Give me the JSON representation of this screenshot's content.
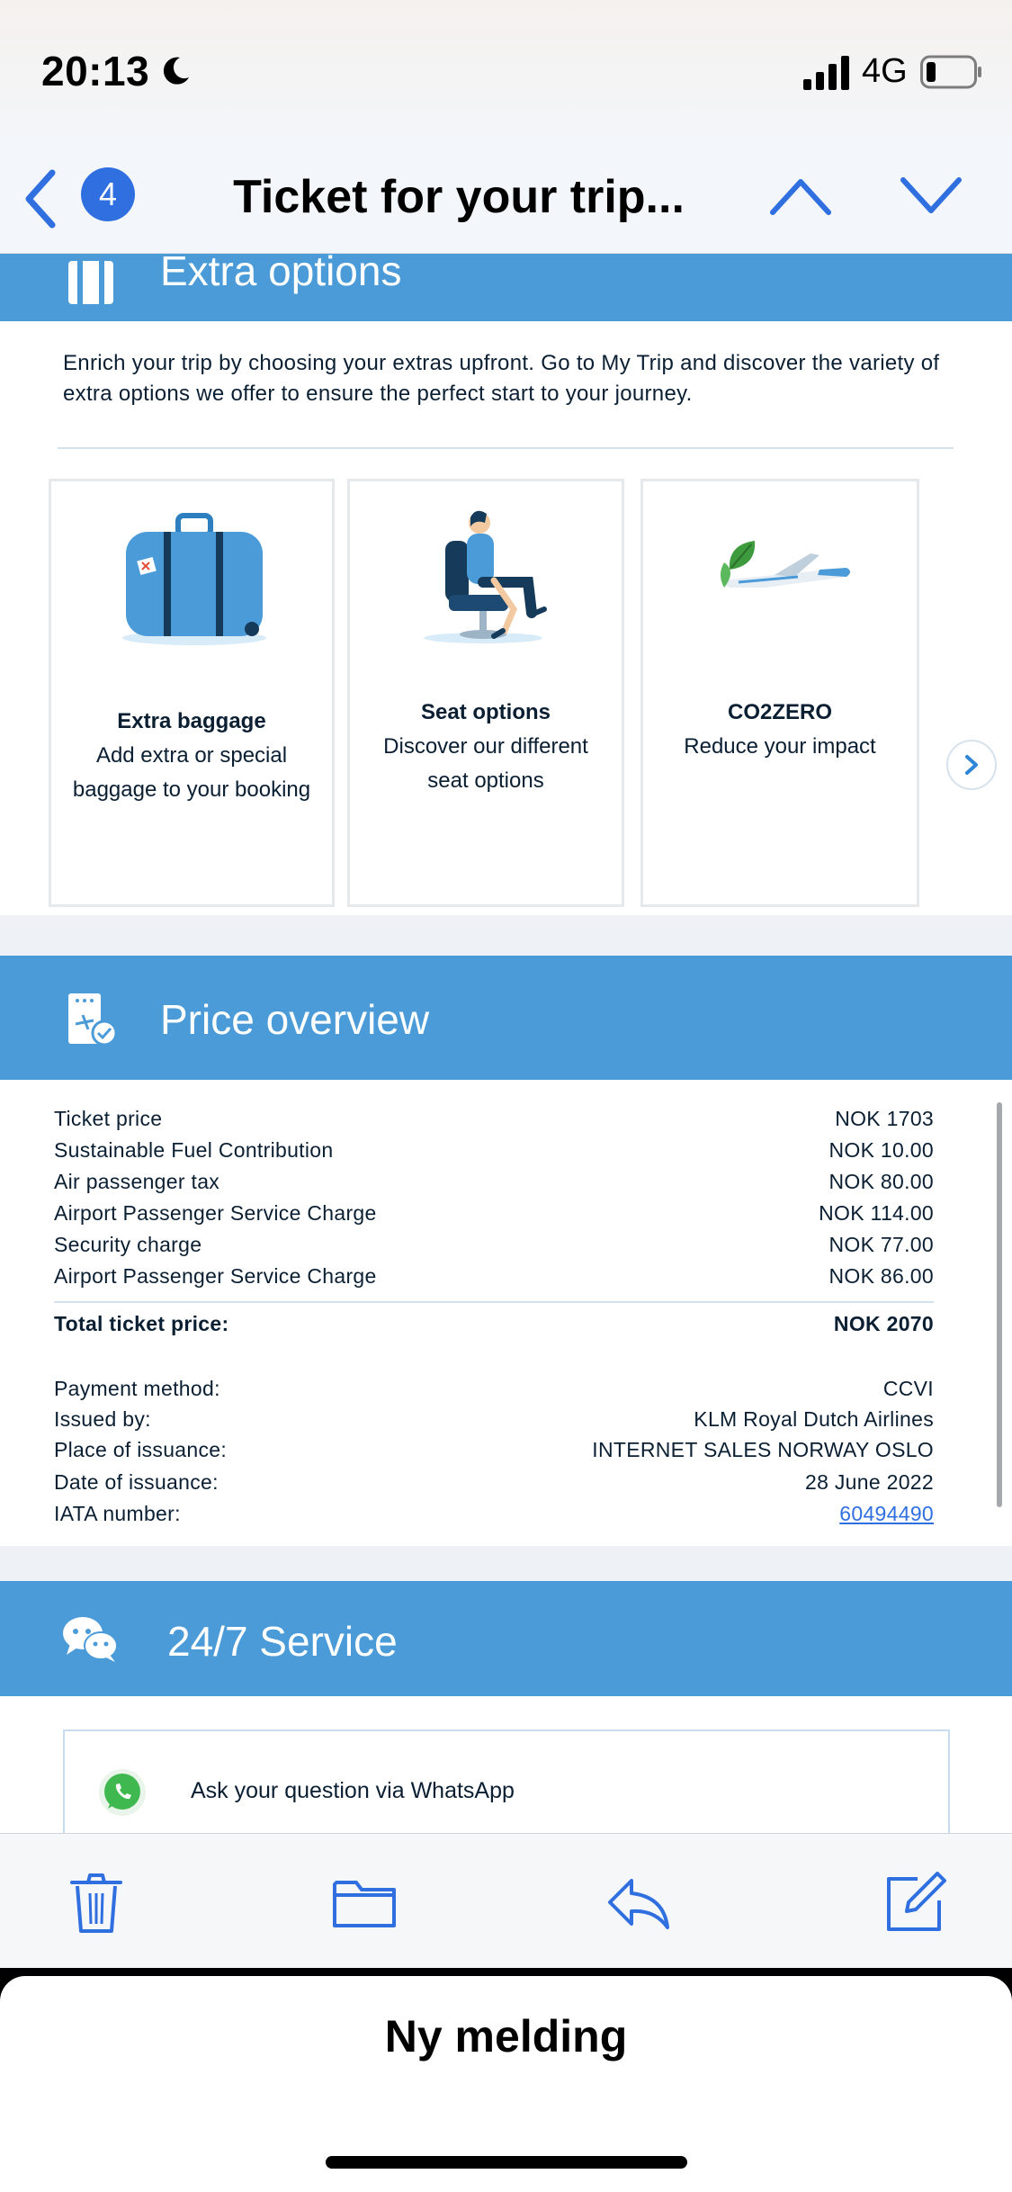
{
  "status_bar": {
    "time": "20:13",
    "network": "4G"
  },
  "nav": {
    "unread_count": "4",
    "title": "Ticket for your trip..."
  },
  "extra_options": {
    "heading": "Extra options",
    "intro": "Enrich your trip by choosing your extras upfront. Go to My Trip and discover the variety of extra options we offer to ensure the perfect start to your journey.",
    "cards": [
      {
        "title": "Extra baggage",
        "desc_line1": "Add extra or special",
        "desc_line2": "baggage to your booking"
      },
      {
        "title": "Seat options",
        "desc_line1": "Discover our different",
        "desc_line2": "seat options"
      },
      {
        "title": "CO2ZERO",
        "desc_line1": "Reduce your impact",
        "desc_line2": ""
      }
    ]
  },
  "price_overview": {
    "heading": "Price overview",
    "lines": [
      {
        "label": "Ticket price",
        "value": "NOK 1703"
      },
      {
        "label": "Sustainable Fuel Contribution",
        "value": "NOK 10.00"
      },
      {
        "label": "Air passenger tax",
        "value": "NOK 80.00"
      },
      {
        "label": "Airport Passenger Service Charge",
        "value": "NOK 114.00"
      },
      {
        "label": "Security charge",
        "value": "NOK 77.00"
      },
      {
        "label": "Airport Passenger Service Charge",
        "value": "NOK 86.00"
      }
    ],
    "total": {
      "label": "Total ticket price:",
      "value": "NOK 2070"
    },
    "details": [
      {
        "label": "Payment method:",
        "value": "CCVI"
      },
      {
        "label": "Issued by:",
        "value": "KLM Royal Dutch Airlines"
      },
      {
        "label": "Place of issuance:",
        "value": "INTERNET SALES NORWAY OSLO"
      },
      {
        "label": "Date of issuance:",
        "value": "28 June 2022"
      },
      {
        "label": "IATA number:",
        "value": "60494490"
      }
    ]
  },
  "service": {
    "heading": "24/7 Service",
    "whatsapp": "Ask your question via WhatsApp"
  },
  "compose_sheet": {
    "title": "Ny melding"
  },
  "colors": {
    "accent": "#2f6fe0",
    "section_blue": "#4a9bd8",
    "whatsapp_green": "#3fb94f"
  }
}
